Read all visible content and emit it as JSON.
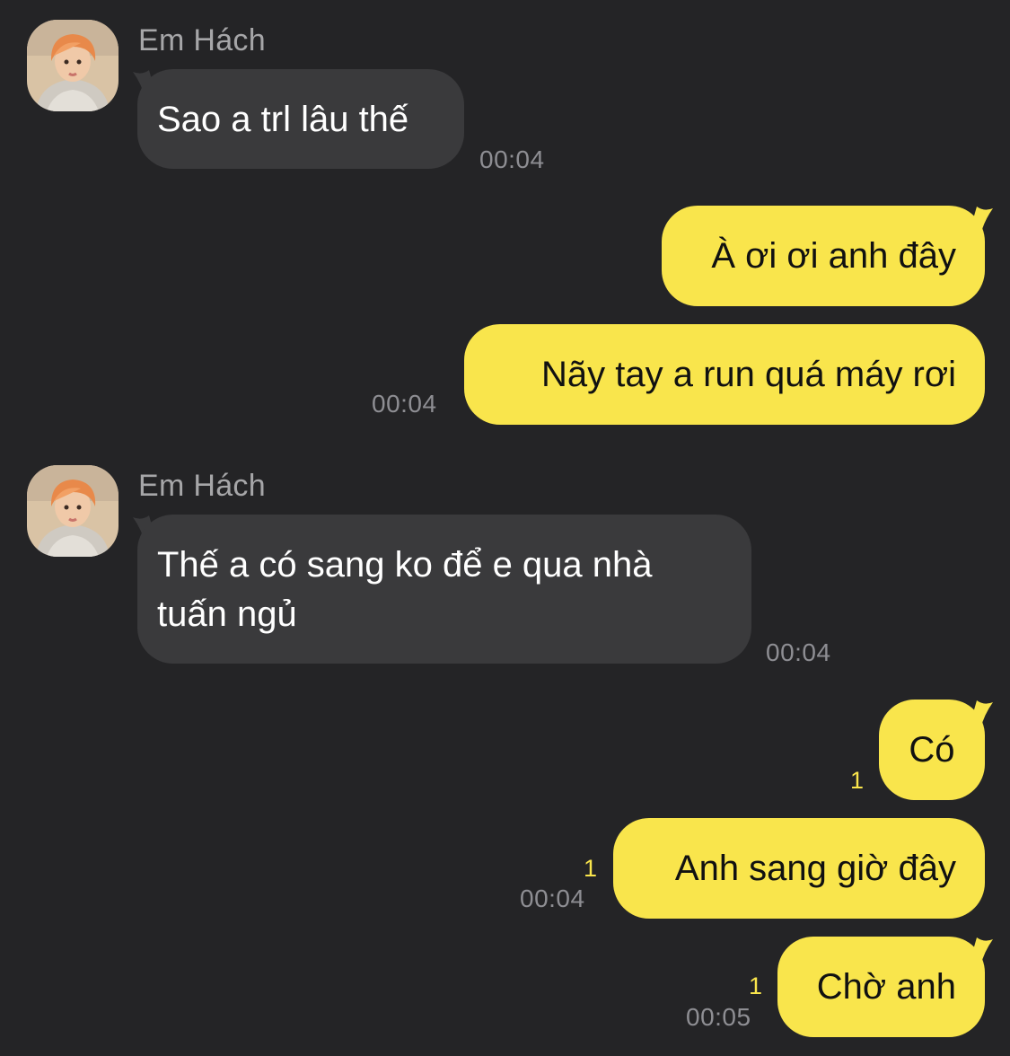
{
  "contact": {
    "name": "Em Hách",
    "avatar_icon": "profile-photo"
  },
  "messages": [
    {
      "side": "in",
      "text": "Sao a trl lâu thế",
      "time": "00:04"
    },
    {
      "side": "out",
      "text": "À ơi ơi anh đây",
      "time": ""
    },
    {
      "side": "out",
      "text": "Nãy tay a run quá máy rơi",
      "time": "00:04"
    },
    {
      "side": "in",
      "text": "Thế a có sang ko để e qua nhà tuấn ngủ",
      "time": "00:04"
    },
    {
      "side": "out",
      "text": "Có",
      "time": "",
      "unread": "1"
    },
    {
      "side": "out",
      "text": "Anh sang giờ đây",
      "time": "00:04",
      "unread": "1"
    },
    {
      "side": "out",
      "text": "Chờ anh",
      "time": "00:05",
      "unread": "1"
    }
  ],
  "colors": {
    "background": "#242426",
    "incoming_bubble": "#3a3a3c",
    "outgoing_bubble": "#f9e54c",
    "timestamp": "#8e8e93",
    "unread_count": "#f9e54c"
  }
}
